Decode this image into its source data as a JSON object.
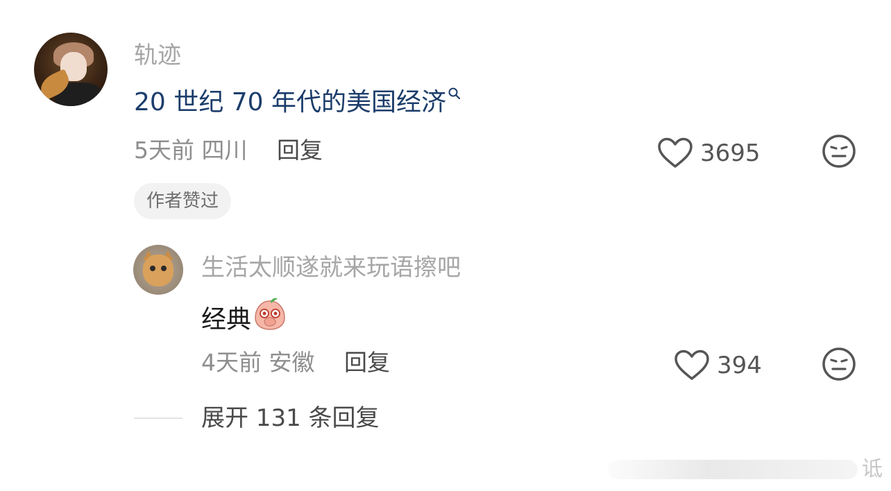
{
  "main_comment": {
    "username": "轨迹",
    "text": "20 世纪 70 年代的美国经济",
    "search_icon": "search-icon",
    "time": "5天前",
    "location": "四川",
    "reply_label": "回复",
    "like_count": "3695",
    "author_badge": "作者赞过"
  },
  "reply_comment": {
    "username": "生活太顺遂就来玩语擦吧",
    "text": "经典",
    "sticker": "peach-face-sticker",
    "time": "4天前",
    "location": "安徽",
    "reply_label": "回复",
    "like_count": "394"
  },
  "expand": {
    "label": "展开 131 条回复"
  },
  "watermark": {
    "text": "诋"
  },
  "colors": {
    "link_blue": "#1c3d6b",
    "muted_gray": "#a6a6a6",
    "badge_bg": "#f2f2f2"
  }
}
